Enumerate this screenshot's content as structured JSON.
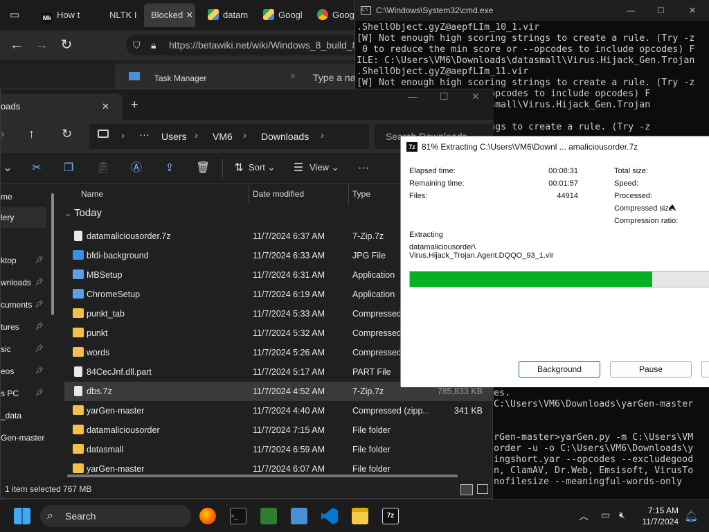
{
  "browser": {
    "tabs": [
      {
        "label": "How t",
        "active": false
      },
      {
        "label": "NLTK I",
        "active": false
      },
      {
        "label": "Blocked",
        "active": true
      },
      {
        "label": "datam",
        "active": false
      },
      {
        "label": "Googl",
        "active": false
      },
      {
        "label": "Googl",
        "active": false
      }
    ],
    "url": "https://betawiki.net/wiki/Windows_8_build_8",
    "taskmanager_title": "Task Manager",
    "taskmanager_search": "Type a na"
  },
  "cmd": {
    "title": "C:\\Windows\\System32\\cmd.exe",
    "lines_top": [
      ".ShellObject.gyZ@aepfLIm_10_1.vir",
      "[W] Not enough high scoring strings to create a rule. (Try -z",
      " 0 to reduce the min score or --opcodes to include opcodes) F",
      "ILE: C:\\Users\\VM6\\Downloads\\datasmall\\Virus.Hijack_Gen.Trojan",
      ".ShellObject.gyZ@aepfLIm_11.vir",
      "[W] Not enough high scoring strings to create a rule. (Try -z",
      "                 e or --opcodes to include opcodes) F",
      "                 ds\\datasmall\\Virus.Hijack_Gen.Trojan",
      "                 2_1.vir",
      "                 ng strings to create a rule. (Try -z"
    ],
    "lines_bottom": [
      "es.",
      "C:\\Users\\VM6\\Downloads\\yarGen-master",
      "",
      "",
      "rGen-master>yarGen.py -m C:\\Users\\VM",
      "order -u -o C:\\Users\\VM6\\Downloads\\y",
      "ingshort.yar --opcodes --excludegood",
      "n, ClamAV, Dr.Web, Emsisoft, VirusTo",
      "nofilesize --meaningful-words-only"
    ]
  },
  "explorer": {
    "tab_title": "oads",
    "breadcrumb": [
      "Users",
      "VM6",
      "Downloads"
    ],
    "search_placeholder": "Search Downloads",
    "sort_label": "Sort",
    "view_label": "View",
    "nav": [
      {
        "label": "me",
        "pinned": false,
        "selected": false
      },
      {
        "label": "lery",
        "pinned": false,
        "selected": true
      },
      {
        "label": "ktop",
        "pinned": true,
        "selected": false
      },
      {
        "label": "wnloads",
        "pinned": true,
        "selected": false
      },
      {
        "label": "cuments",
        "pinned": true,
        "selected": false
      },
      {
        "label": "tures",
        "pinned": true,
        "selected": false
      },
      {
        "label": "sic",
        "pinned": true,
        "selected": false
      },
      {
        "label": "eos",
        "pinned": true,
        "selected": false
      },
      {
        "label": "s PC",
        "pinned": true,
        "selected": false
      },
      {
        "label": "_data",
        "pinned": false,
        "selected": false
      },
      {
        "label": "Gen-master",
        "pinned": false,
        "selected": false
      }
    ],
    "columns": {
      "name": "Name",
      "date": "Date modified",
      "type": "Type"
    },
    "group": "Today",
    "files": [
      {
        "name": "datamaliciousorder.7z",
        "date": "11/7/2024 6:37 AM",
        "type": "7-Zip.7z",
        "size": "",
        "icon": "file-icon"
      },
      {
        "name": "bfdi-background",
        "date": "11/7/2024 6:33 AM",
        "type": "JPG File",
        "size": "",
        "icon": "image-icon"
      },
      {
        "name": "MBSetup",
        "date": "11/7/2024 6:31 AM",
        "type": "Application",
        "size": "",
        "icon": "app-icon"
      },
      {
        "name": "ChromeSetup",
        "date": "11/7/2024 6:19 AM",
        "type": "Application",
        "size": "",
        "icon": "app-icon"
      },
      {
        "name": "punkt_tab",
        "date": "11/7/2024 5:33 AM",
        "type": "Compressed",
        "size": "",
        "icon": "zip-folder-icon"
      },
      {
        "name": "punkt",
        "date": "11/7/2024 5:32 AM",
        "type": "Compressed",
        "size": "",
        "icon": "zip-folder-icon"
      },
      {
        "name": "words",
        "date": "11/7/2024 5:26 AM",
        "type": "Compressed",
        "size": "",
        "icon": "zip-folder-icon"
      },
      {
        "name": "84CecJnf.dll.part",
        "date": "11/7/2024 5:17 AM",
        "type": "PART File",
        "size": "",
        "icon": "file-icon"
      },
      {
        "name": "dbs.7z",
        "date": "11/7/2024 4:52 AM",
        "type": "7-Zip.7z",
        "size": "785,833 KB",
        "icon": "file-icon",
        "selected": true
      },
      {
        "name": "yarGen-master",
        "date": "11/7/2024 4:40 AM",
        "type": "Compressed (zipp...",
        "size": "341 KB",
        "icon": "zip-folder-icon"
      },
      {
        "name": "datamaliciousorder",
        "date": "11/7/2024 7:15 AM",
        "type": "File folder",
        "size": "",
        "icon": "folder-icon"
      },
      {
        "name": "datasmall",
        "date": "11/7/2024 6:59 AM",
        "type": "File folder",
        "size": "",
        "icon": "folder-icon"
      },
      {
        "name": "yarGen-master",
        "date": "11/7/2024 6:07 AM",
        "type": "File folder",
        "size": "",
        "icon": "folder-icon"
      }
    ],
    "status": "1 item selected  767 MB"
  },
  "zip": {
    "title": "81% Extracting C:\\Users\\VM6\\Downl ... amaliciousorder.7z",
    "elapsed_label": "Elapsed time:",
    "elapsed_value": "00:08:31",
    "remaining_label": "Remaining time:",
    "remaining_value": "00:01:57",
    "files_label": "Files:",
    "files_value": "44914",
    "total_label": "Total size:",
    "speed_label": "Speed:",
    "processed_label": "Processed:",
    "compressed_label": "Compressed size:",
    "ratio_label": "Compression ratio:",
    "extracting_label": "Extracting",
    "path_line1": "datamaliciousorder\\",
    "path_line2": "Virus.Hijack_Trojan.Agent.DQQO_93_1.vir",
    "progress": 0.81,
    "background_label": "Background",
    "pause_label": "Pause",
    "progress_color": "#06b025"
  },
  "taskbar": {
    "search_label": "Search",
    "time": "7:15 AM",
    "date": "11/7/2024"
  }
}
